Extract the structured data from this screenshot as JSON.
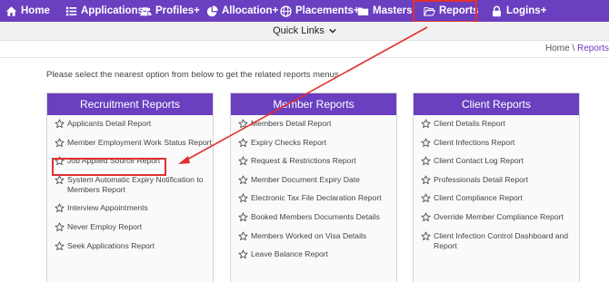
{
  "nav": {
    "home": "Home",
    "applications": "Applications+",
    "profiles": "Profiles+",
    "allocation": "Allocation+",
    "placements": "Placements+",
    "masters": "Masters",
    "reports": "Reports",
    "logins": "Logins+"
  },
  "quick_links": "Quick Links",
  "breadcrumb": {
    "home": "Home",
    "sep": " \\ ",
    "current": "Reports"
  },
  "intro": "Please select the nearest option from below to get the related reports menus",
  "recruitment": {
    "title": "Recruitment Reports",
    "items": [
      "Applicants Detail Report",
      "Member Employment Work Status Report",
      "Job Applied Source Report",
      "System Automatic Expiry Notification to Members Report",
      "Interview Appointments",
      "Never Employ Report",
      "Seek Applications Report"
    ]
  },
  "member": {
    "title": "Member Reports",
    "items": [
      "Members Detail Report",
      "Expiry Checks Report",
      "Request & Restrictions Report",
      "Member Document Expiry Date",
      "Electronic Tax File Declaration Report",
      "Booked Members Documents Details",
      "Members Worked on Visa Details",
      "Leave Balance Report"
    ]
  },
  "client": {
    "title": "Client Reports",
    "items": [
      "Client Details Report",
      "Client Infections Report",
      "Client Contact Log Report",
      "Professionals Detail Report",
      "Client Compliance Report",
      "Override Member Compliance Report",
      "Client Infection Control Dashboard and Report"
    ]
  },
  "colors": {
    "nav_bg": "#6a3fc0",
    "panel_head": "#6a3fc0",
    "highlight": "#e03030"
  },
  "icons": [
    "home-icon",
    "list-icon",
    "users-icon",
    "pie-chart-icon",
    "globe-icon",
    "folder-icon",
    "folder-open-icon",
    "lock-icon",
    "chevron-down-icon",
    "star-icon"
  ]
}
